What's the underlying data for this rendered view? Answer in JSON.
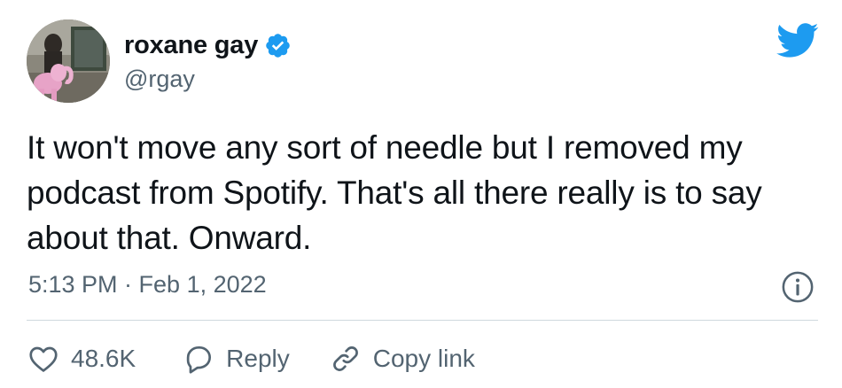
{
  "author": {
    "display_name": "roxane gay",
    "handle": "@rgay",
    "verified": true,
    "avatar_alt": "profile photo"
  },
  "tweet": {
    "text": "It won't move any sort of needle but I removed my podcast from Spotify. That's all there really is to say about that. Onward.",
    "timestamp": "5:13 PM · Feb 1, 2022"
  },
  "actions": {
    "like_count": "48.6K",
    "reply_label": "Reply",
    "copy_link_label": "Copy link"
  },
  "icons": {
    "verified": "verified-badge-icon",
    "brand": "twitter-bird-icon",
    "info": "info-icon",
    "like": "heart-icon",
    "reply": "speech-bubble-icon",
    "copy_link": "link-icon"
  },
  "colors": {
    "brand_blue": "#1d9bf0",
    "text_primary": "#0f1419",
    "text_secondary": "#536471",
    "divider": "#cfd9de"
  }
}
